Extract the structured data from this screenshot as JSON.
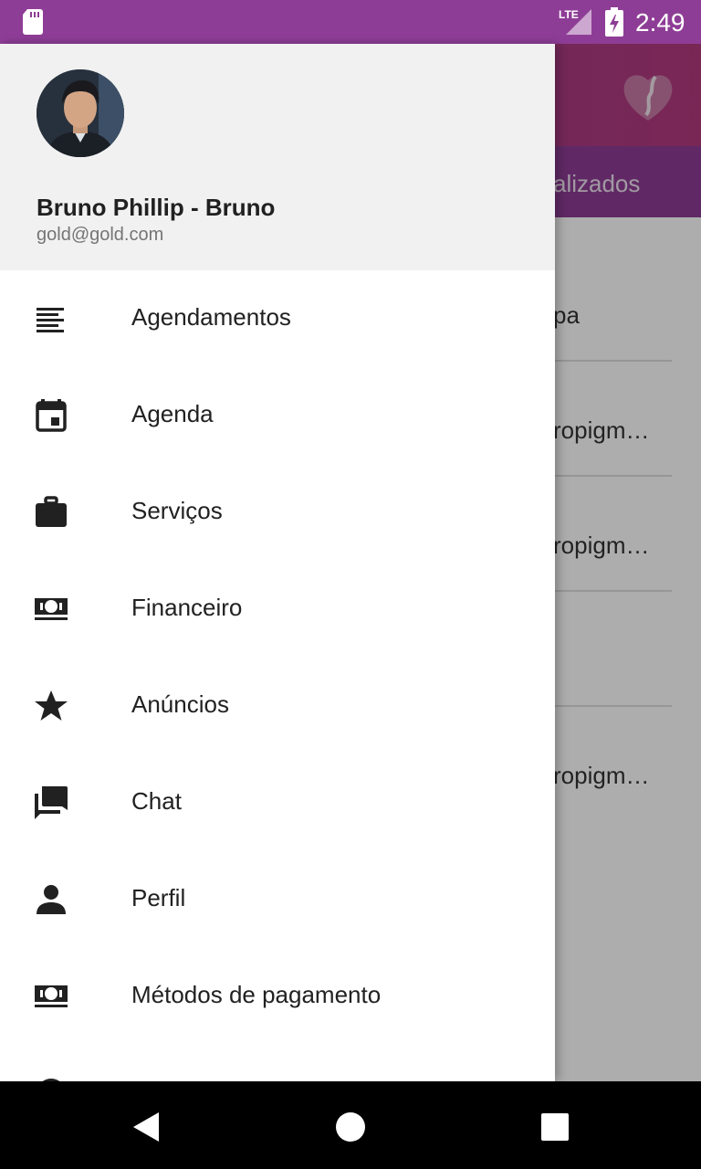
{
  "status_bar": {
    "time": "2:49",
    "network": "LTE",
    "icons": [
      "sd-card-icon",
      "lte-signal-icon",
      "battery-charging-icon"
    ]
  },
  "background": {
    "tab_label": "alizados",
    "rows": [
      "pa",
      "ropigm…",
      "ropigm…",
      "",
      "ropigm…"
    ]
  },
  "drawer": {
    "user": {
      "name": "Bruno Phillip - Bruno",
      "email": "gold@gold.com"
    },
    "items": [
      {
        "label": "Agendamentos",
        "icon": "list-icon"
      },
      {
        "label": "Agenda",
        "icon": "calendar-icon"
      },
      {
        "label": "Serviços",
        "icon": "briefcase-icon"
      },
      {
        "label": "Financeiro",
        "icon": "money-icon"
      },
      {
        "label": "Anúncios",
        "icon": "star-icon"
      },
      {
        "label": "Chat",
        "icon": "chat-icon"
      },
      {
        "label": "Perfil",
        "icon": "person-icon"
      },
      {
        "label": "Métodos de pagamento",
        "icon": "money-icon"
      }
    ]
  },
  "nav_bar": {
    "buttons": [
      "back-icon",
      "home-icon",
      "recents-icon"
    ]
  },
  "colors": {
    "primary": "#8e3d96",
    "accent": "#b33a7e",
    "text": "#212121",
    "secondary_text": "#757575"
  }
}
